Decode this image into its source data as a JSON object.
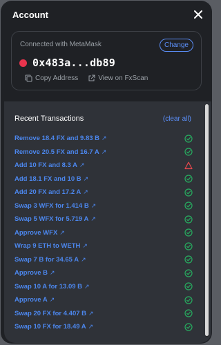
{
  "header": {
    "title": "Account"
  },
  "account": {
    "connected_text": "Connected with MetaMask",
    "change_label": "Change",
    "address": "0x483a...db89",
    "copy_label": "Copy Address",
    "view_label": "View on FxScan"
  },
  "transactions": {
    "heading": "Recent Transactions",
    "clear_label": "(clear all)",
    "items": [
      {
        "label": "Remove 18.4 FX and 9.83 B",
        "status": "success"
      },
      {
        "label": "Remove 20.5 FX and 16.7 A",
        "status": "success"
      },
      {
        "label": "Add 10 FX and 8.3 A",
        "status": "failed"
      },
      {
        "label": "Add 18.1 FX and 10 B",
        "status": "success"
      },
      {
        "label": "Add 20 FX and 17.2 A",
        "status": "success"
      },
      {
        "label": "Swap 3 WFX for 1.414 B",
        "status": "success"
      },
      {
        "label": "Swap 5 WFX for 5.719 A",
        "status": "success"
      },
      {
        "label": "Approve WFX",
        "status": "success"
      },
      {
        "label": "Wrap 9 ETH to WETH",
        "status": "success"
      },
      {
        "label": "Swap 7 B for 34.65 A",
        "status": "success"
      },
      {
        "label": "Approve B",
        "status": "success"
      },
      {
        "label": "Swap 10 A for 13.09 B",
        "status": "success"
      },
      {
        "label": "Approve A",
        "status": "success"
      },
      {
        "label": "Swap 20 FX for 4.407 B",
        "status": "success"
      },
      {
        "label": "Swap 10 FX for 18.49 A",
        "status": "success"
      }
    ]
  },
  "icons": {
    "close": "close-icon",
    "copy": "copy-icon",
    "external": "external-link-icon",
    "success": "check-circle-icon",
    "failed": "alert-triangle-icon"
  },
  "colors": {
    "accent": "#5b8ff9",
    "link": "#4c87ee",
    "success": "#27ae60",
    "failed": "#e5484d",
    "wallet_dot": "#e8344d"
  }
}
